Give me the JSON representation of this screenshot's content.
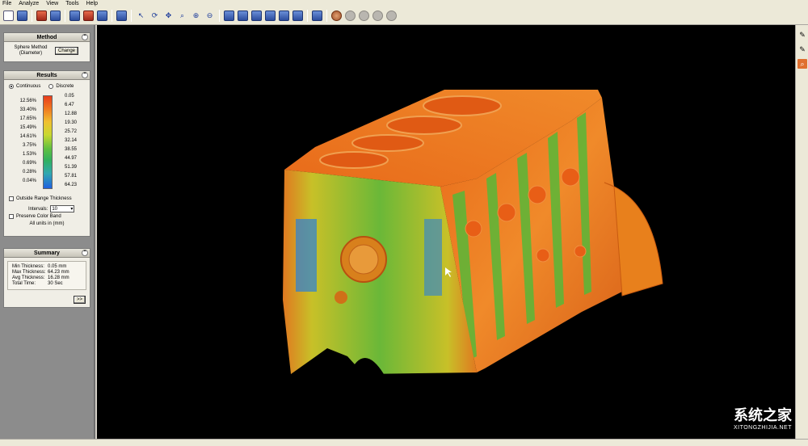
{
  "menu": [
    "File",
    "Analyze",
    "View",
    "Tools",
    "Help"
  ],
  "toolbar": {
    "icons": [
      "new-file-icon",
      "open-file-icon",
      "export-icon",
      "print-icon",
      "section-icon",
      "analyze-icon",
      "settings-icon",
      "model-icon",
      "select-arrow-icon",
      "rotate-icon",
      "pan-icon",
      "zoom-window-icon",
      "zoom-in-icon",
      "zoom-out-icon",
      "view-front-icon",
      "view-back-icon",
      "view-top-icon",
      "view-bottom-icon",
      "view-left-icon",
      "view-right-icon",
      "view-iso-icon",
      "render-icon",
      "probe-icon",
      "annotate-icon",
      "light-icon",
      "record-icon"
    ]
  },
  "method": {
    "title": "Method",
    "label_line1": "Sphere Method",
    "label_line2": "(Diameter)",
    "change_button": "Change"
  },
  "results": {
    "title": "Results",
    "continuous": "Continuous",
    "discrete": "Discrete",
    "percents": [
      "12.56%",
      "33.40%",
      "17.65%",
      "15.49%",
      "14.61%",
      "3.75%",
      "1.53%",
      "0.69%",
      "0.28%",
      "0.04%"
    ],
    "values": [
      "0.05",
      "6.47",
      "12.88",
      "19.30",
      "25.72",
      "32.14",
      "38.55",
      "44.97",
      "51.39",
      "57.81",
      "64.23"
    ],
    "outside_range": "Outside Range Thickness",
    "intervals_label": "Intervals:",
    "intervals_value": "10",
    "preserve_band": "Preserve Color Band",
    "units": "All units in (mm)"
  },
  "summary": {
    "title": "Summary",
    "rows": [
      {
        "label": "Min Thickness:",
        "value": "0.05 mm"
      },
      {
        "label": "Max Thickness:",
        "value": "64.23 mm"
      },
      {
        "label": "Avg Thickness:",
        "value": "16.28 mm"
      },
      {
        "label": "Total Time:",
        "value": "30 Sec"
      }
    ],
    "more_button": ">>"
  },
  "watermark": {
    "main": "系统之家",
    "sub": "XITONGZHIJIA.NET"
  },
  "colors": {
    "viewport_bg": "#000000",
    "model_orange": "#e8701c",
    "model_green": "#58b838",
    "model_blue": "#2a80d8",
    "model_yellow": "#d8c030"
  }
}
